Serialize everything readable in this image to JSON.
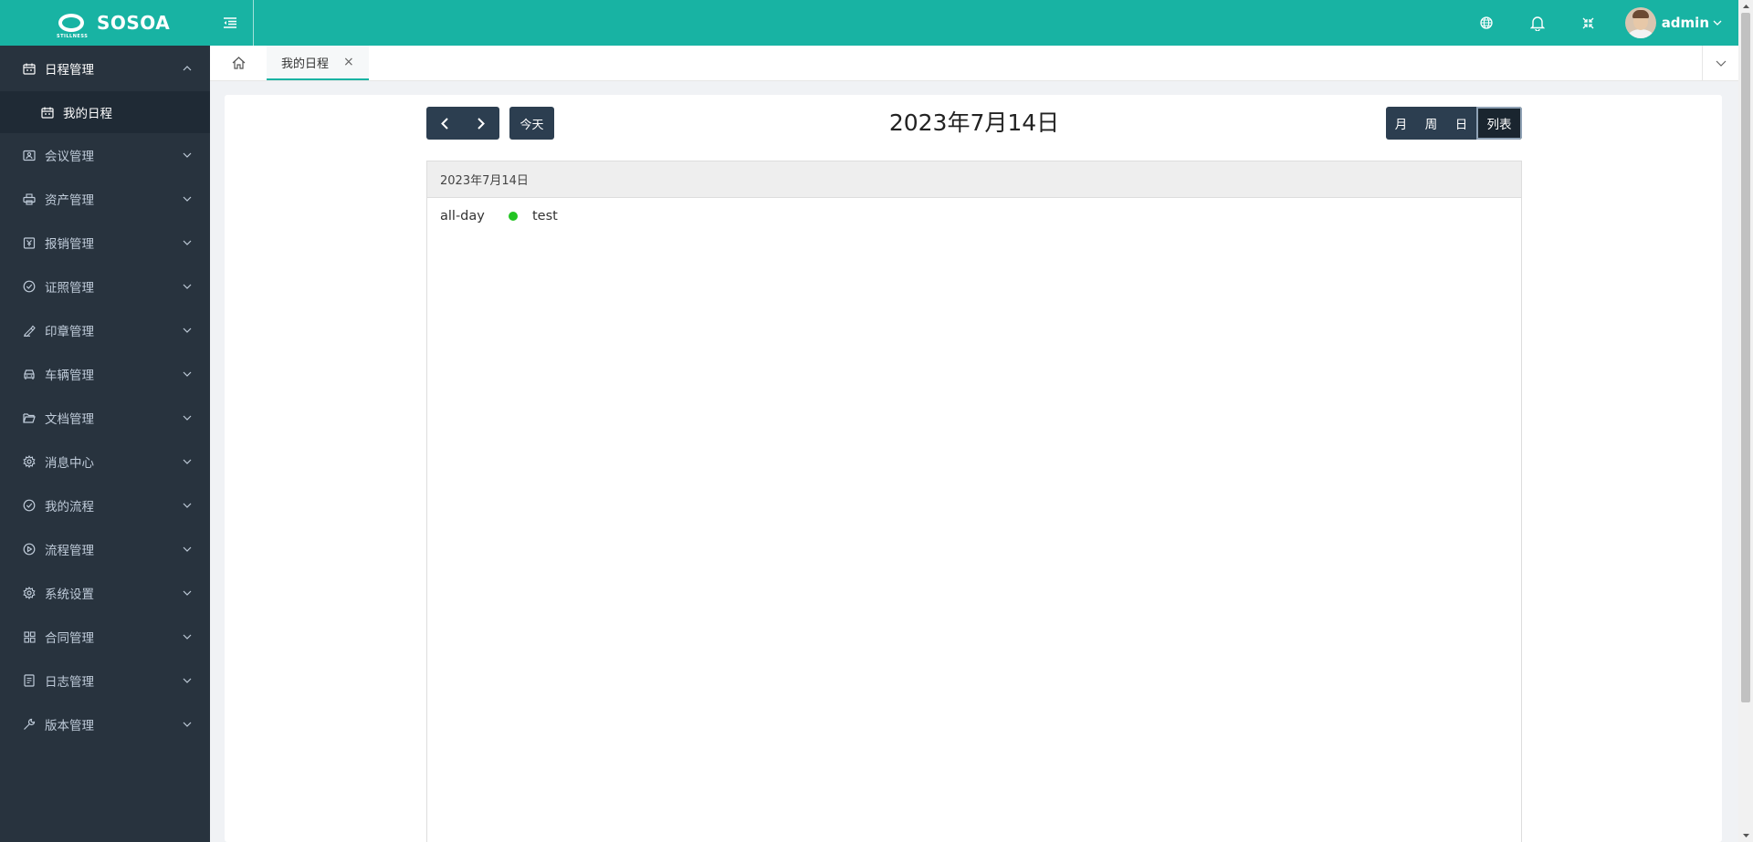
{
  "app": {
    "name": "SOSOA",
    "logo_sub": "STILLNESS"
  },
  "header": {
    "user_name": "admin"
  },
  "sidebar": {
    "open_group": {
      "label": "日程管理",
      "children": [
        {
          "label": "我的日程"
        }
      ]
    },
    "items": [
      {
        "label": "会议管理"
      },
      {
        "label": "资产管理"
      },
      {
        "label": "报销管理"
      },
      {
        "label": "证照管理"
      },
      {
        "label": "印章管理"
      },
      {
        "label": "车辆管理"
      },
      {
        "label": "文档管理"
      },
      {
        "label": "消息中心"
      },
      {
        "label": "我的流程"
      },
      {
        "label": "流程管理"
      },
      {
        "label": "系统设置"
      },
      {
        "label": "合同管理"
      },
      {
        "label": "日志管理"
      },
      {
        "label": "版本管理"
      }
    ]
  },
  "tabs": [
    {
      "label": "我的日程"
    }
  ],
  "calendar": {
    "title": "2023年7月14日",
    "today_label": "今天",
    "views": [
      {
        "label": "月"
      },
      {
        "label": "周"
      },
      {
        "label": "日"
      },
      {
        "label": "列表"
      }
    ],
    "active_view": "列表",
    "list": {
      "day_heading": "2023年7月14日",
      "events": [
        {
          "time": "all-day",
          "title": "test",
          "color": "#22c422"
        }
      ]
    }
  },
  "colors": {
    "accent": "#18b3a3",
    "sidebar": "#28333e",
    "button": "#2c3e50"
  }
}
